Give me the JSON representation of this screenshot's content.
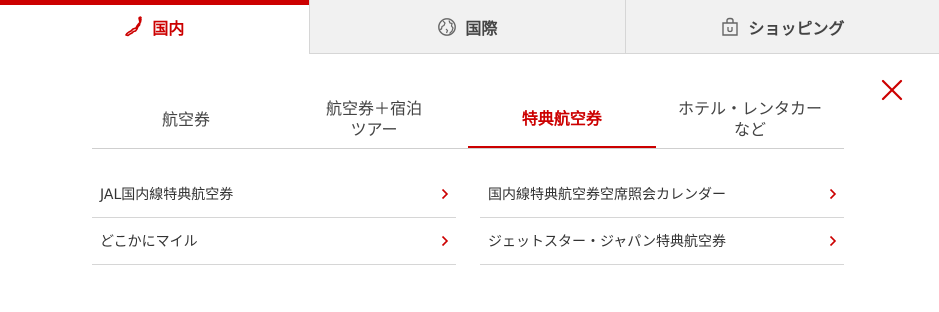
{
  "colors": {
    "accent": "#cc0000",
    "tab_inactive_bg": "#f1f1f1",
    "text": "#333333",
    "divider": "#d6d6d6"
  },
  "region_tabs": [
    {
      "label": "国内",
      "icon": "japan-map-icon",
      "active": true
    },
    {
      "label": "国際",
      "icon": "globe-icon",
      "active": false
    },
    {
      "label": "ショッピング",
      "icon": "shopping-bag-icon",
      "active": false
    }
  ],
  "close": {
    "icon": "close-icon"
  },
  "category_tabs": [
    {
      "label": "航空券",
      "active": false
    },
    {
      "label": "航空券＋宿泊\nツアー",
      "active": false
    },
    {
      "label": "特典航空券",
      "active": true
    },
    {
      "label": "ホテル・レンタカー\nなど",
      "active": false
    }
  ],
  "links_left": [
    {
      "label": "JAL国内線特典航空券",
      "icon": "chevron-right-icon"
    },
    {
      "label": "どこかにマイル",
      "icon": "chevron-right-icon"
    }
  ],
  "links_right": [
    {
      "label": "国内線特典航空券空席照会カレンダー",
      "icon": "chevron-right-icon"
    },
    {
      "label": "ジェットスター・ジャパン特典航空券",
      "icon": "chevron-right-icon"
    }
  ]
}
